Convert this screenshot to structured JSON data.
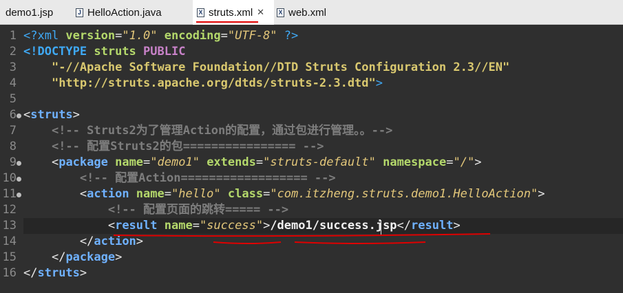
{
  "tabs": [
    {
      "label": "demo1.jsp",
      "icon": "jsp-file-icon",
      "active": false
    },
    {
      "label": "HelloAction.java",
      "icon": "java-file-icon",
      "active": false
    },
    {
      "label": "struts.xml",
      "icon": "xml-file-icon",
      "active": true
    },
    {
      "label": "web.xml",
      "icon": "xml-file-icon",
      "active": false
    }
  ],
  "tab_icon_letter": "X",
  "tab_java_letter": "J",
  "close_glyph": "✕",
  "line_numbers": [
    "1",
    "2",
    "3",
    "4",
    "5",
    "6",
    "7",
    "8",
    "9",
    "10",
    "11",
    "12",
    "13",
    "14",
    "15",
    "16"
  ],
  "code": {
    "l1": {
      "open": "<?xml ",
      "a1": "version",
      "eq": "=",
      "v1": "\"1.0\"",
      "a2": " encoding",
      "eq2": "=",
      "v2": "\"UTF-8\"",
      "close": " ?>"
    },
    "l2": {
      "open": "<!DOCTYPE ",
      "name": "struts",
      "kw": " PUBLIC"
    },
    "l3": {
      "indent": "    ",
      "text": "\"-//Apache Software Foundation//DTD Struts Configuration 2.3//EN\""
    },
    "l4": {
      "indent": "    ",
      "text": "\"http://struts.apache.org/dtds/struts-2.3.dtd\"",
      "close": ">"
    },
    "l5": {
      "text": ""
    },
    "l6": {
      "lt": "<",
      "tag": "struts",
      "gt": ">"
    },
    "l7": {
      "indent": "    ",
      "text": "<!-- Struts2为了管理Action的配置，通过包进行管理。。-->"
    },
    "l8": {
      "indent": "    ",
      "text": "<!-- 配置Struts2的包================ -->"
    },
    "l9": {
      "indent": "    ",
      "lt": "<",
      "tag": "package",
      "a1": " name",
      "eq": "=",
      "v1": "\"demo1\"",
      "a2": " extends",
      "eq2": "=",
      "v2": "\"struts-default\"",
      "a3": " namespace",
      "eq3": "=",
      "v3": "\"/\"",
      "gt": ">"
    },
    "l10": {
      "indent": "        ",
      "text": "<!-- 配置Action================== -->"
    },
    "l11": {
      "indent": "        ",
      "lt": "<",
      "tag": "action",
      "a1": " name",
      "eq": "=",
      "v1": "\"hello\"",
      "a2": " class",
      "eq2": "=",
      "v2": "\"com.itzheng.struts.demo1.HelloAction\"",
      "gt": ">"
    },
    "l12": {
      "indent": "            ",
      "text": "<!-- 配置页面的跳转===== -->"
    },
    "l13": {
      "indent": "            ",
      "lt": "<",
      "tag": "result",
      "a1": " name",
      "eq": "=",
      "v1": "\"success\"",
      "gt": ">",
      "text": "/demo1/success.jsp",
      "lt2": "</",
      "tag2": "result",
      "gt2": ">"
    },
    "l14": {
      "indent": "        ",
      "lt": "</",
      "tag": "action",
      "gt": ">"
    },
    "l15": {
      "indent": "    ",
      "lt": "</",
      "tag": "package",
      "gt": ">"
    },
    "l16": {
      "lt": "</",
      "tag": "struts",
      "gt": ">"
    }
  },
  "colors": {
    "background": "#2f2f2f",
    "tag": "#6fb1ff",
    "attribute": "#b4d86b",
    "string": "#e3c77a",
    "comment": "#7d7d7d",
    "annotation": "#e00000"
  }
}
